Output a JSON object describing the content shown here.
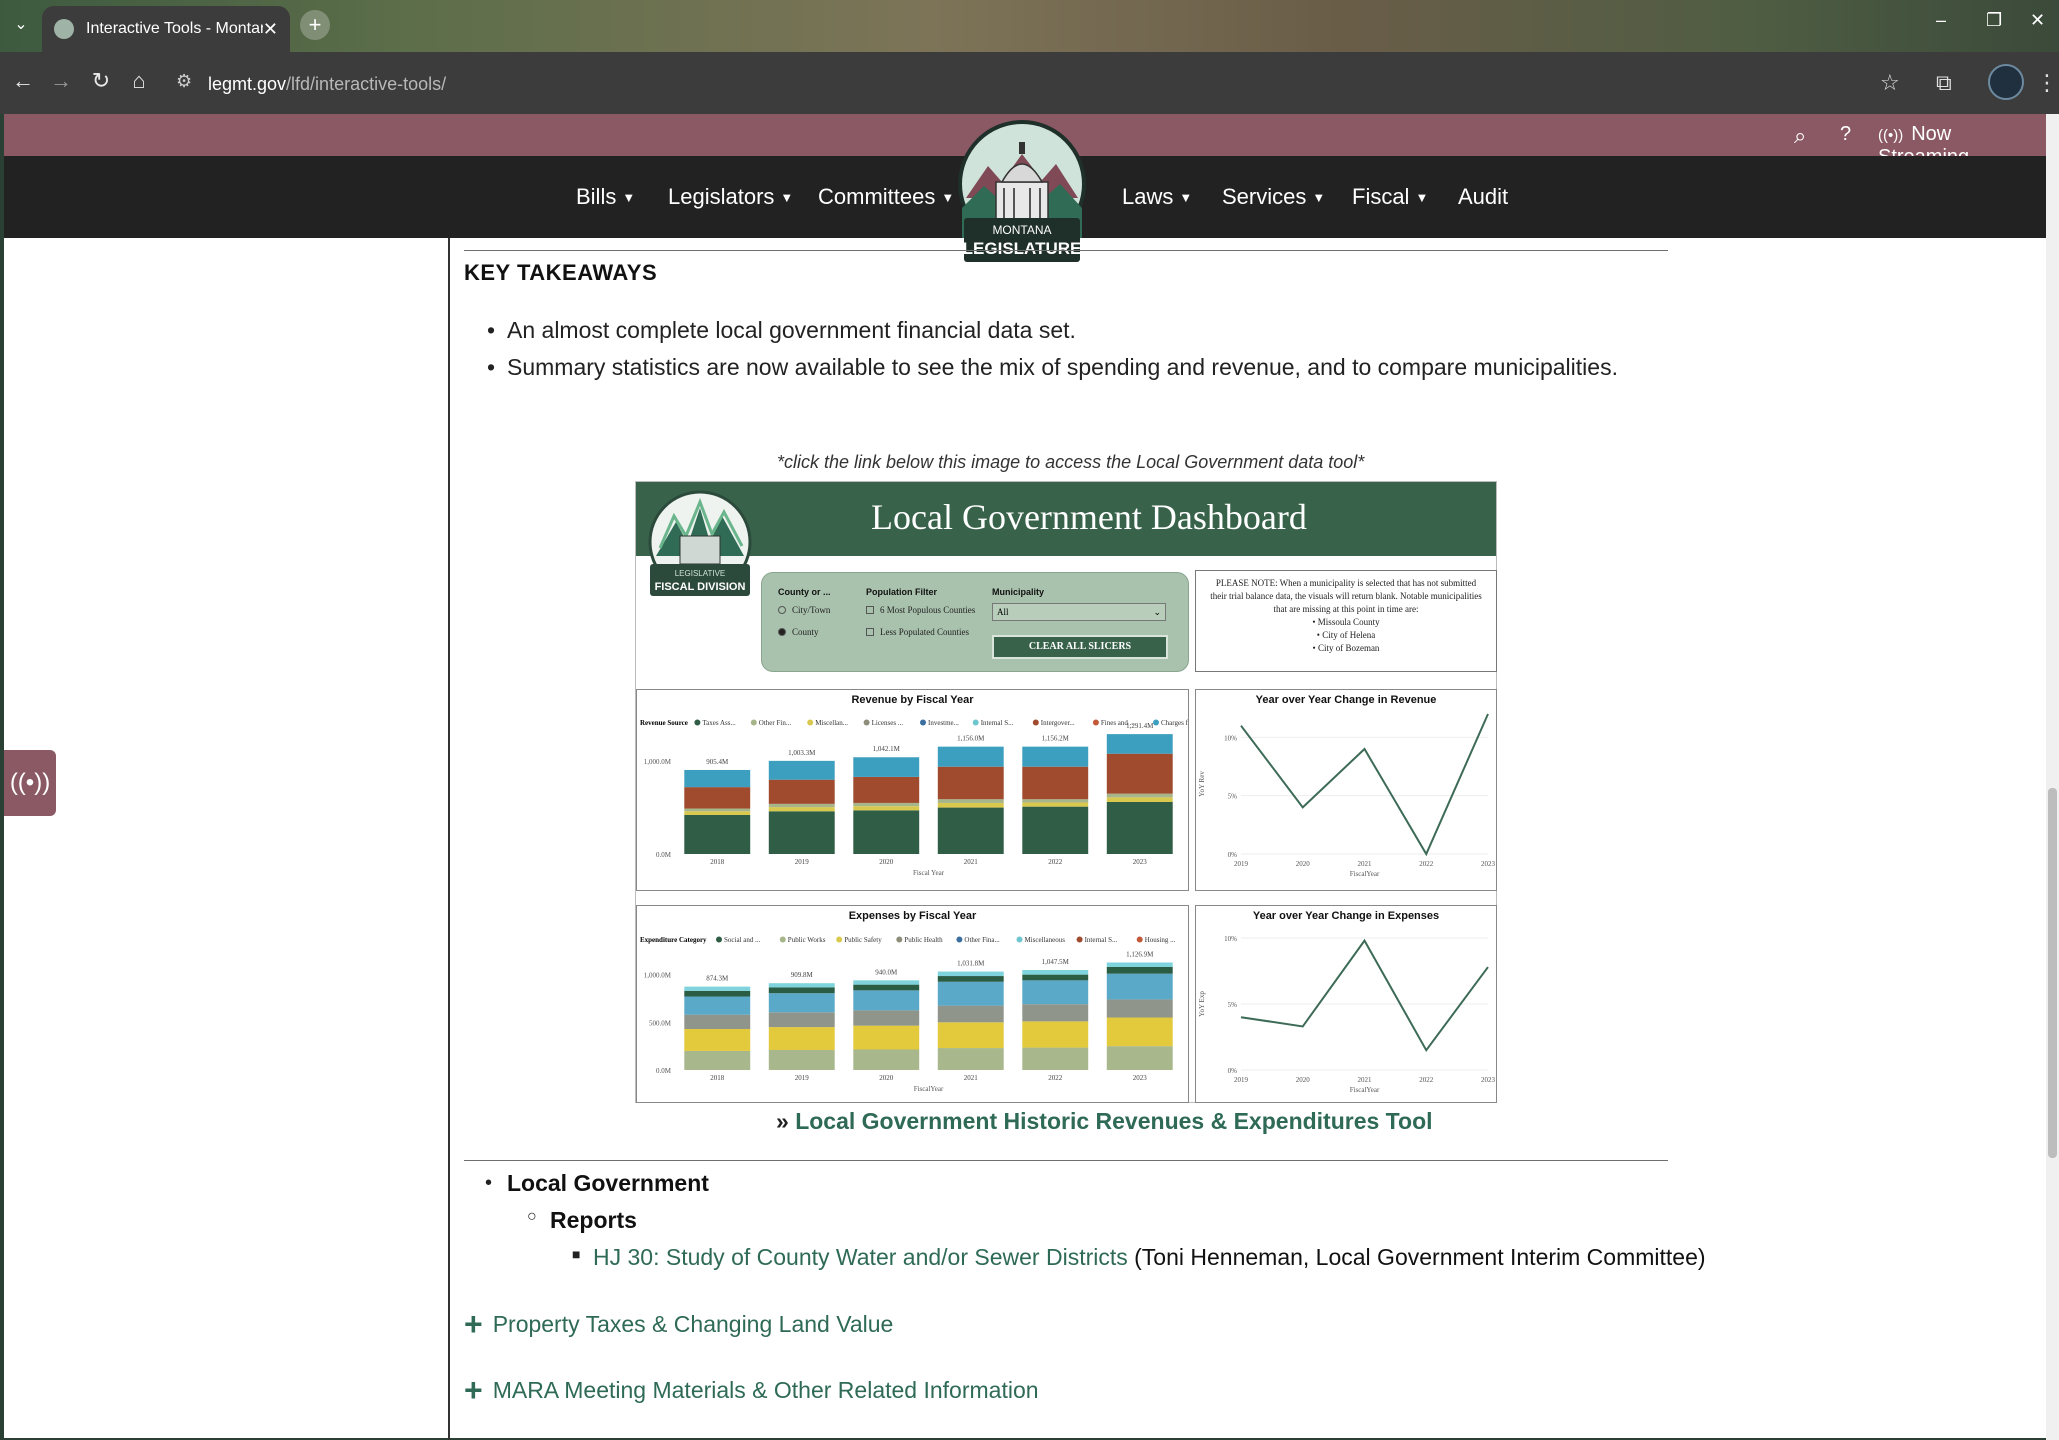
{
  "browser": {
    "tab_title": "Interactive Tools - Montana Leg",
    "tab_close": "✕",
    "new_tab": "+",
    "url_domain": "legmt.gov",
    "url_path": "/lfd/interactive-tools/",
    "window_controls": {
      "minimize": "–",
      "restore": "❐",
      "close": "✕"
    }
  },
  "site": {
    "utility": {
      "search_glyph": "⌕",
      "help": "?",
      "streaming_glyph": "((•))",
      "streaming_label": "Now Streaming"
    },
    "nav_left": [
      {
        "label": "Bills"
      },
      {
        "label": "Legislators"
      },
      {
        "label": "Committees"
      }
    ],
    "nav_right": [
      {
        "label": "Laws"
      },
      {
        "label": "Services"
      },
      {
        "label": "Fiscal"
      },
      {
        "label": "Audit"
      }
    ],
    "logo": {
      "line1": "MONTANA",
      "line2": "LEGISLATURE"
    },
    "side_button_glyph": "((•))"
  },
  "content": {
    "key_takeaways_heading": "KEY TAKEAWAYS",
    "takeaways": [
      "An almost complete local government financial data set.",
      "Summary statistics are now available to see the mix of spending and revenue, and to compare municipalities."
    ],
    "image_caption": "*click the link below this image to access the Local Government data tool*",
    "tool_link_prefix": "»",
    "tool_link": "Local Government Historic Revenues & Expenditures Tool",
    "list": {
      "section": "Local Government",
      "subsection": "Reports",
      "report_link": "HJ 30: Study of County Water and/or Sewer Districts",
      "report_note": " (Toni Henneman, Local Government Interim Committee)"
    },
    "accordions": [
      {
        "label": "Property Taxes & Changing Land Value"
      },
      {
        "label": "MARA Meeting Materials & Other Related Information"
      }
    ]
  },
  "dashboard": {
    "title": "Local Government Dashboard",
    "logo_line1": "LEGISLATIVE",
    "logo_line2": "FISCAL DIVISION",
    "slicers": {
      "county_label": "County or ...",
      "county_options": [
        "City/Town",
        "County"
      ],
      "population_label": "Population Filter",
      "population_options": [
        "6 Most Populous Counties",
        "Less Populated Counties"
      ],
      "municipality_label": "Municipality",
      "municipality_value": "All",
      "clear_label": "CLEAR ALL SLICERS"
    },
    "note_lines": [
      "PLEASE NOTE: When a municipality is selected that has not submitted",
      "their trial balance data, the visuals will return blank. Notable municipalities",
      "that are missing at this point in time are:",
      "• Missoula County",
      "• City of Helena",
      "• City of Bozeman"
    ]
  },
  "chart_data": [
    {
      "type": "bar",
      "title": "Revenue by Fiscal Year",
      "legend_title": "Revenue Source",
      "legend_labels": [
        "Taxes Ass...",
        "Other Fin...",
        "Miscellan...",
        "Licenses ...",
        "Investme...",
        "Internal S...",
        "Intergover...",
        "Fines and ...",
        "Charges f..."
      ],
      "xlabel": "Fiscal Year",
      "categories": [
        "2018",
        "2019",
        "2020",
        "2021",
        "2022",
        "2023"
      ],
      "totals": [
        905.4,
        1003.3,
        1042.1,
        1156.0,
        1156.2,
        1291.4
      ],
      "total_labels": [
        "905.4M",
        "1,003.3M",
        "1,042.1M",
        "1,156.0M",
        "1,156.2M",
        "1,291.4M"
      ],
      "yticks": [
        "0.0M",
        "1,000.0M"
      ],
      "ylim": [
        0,
        1400
      ],
      "series": [
        {
          "color": "#2f5d45",
          "values": [
            420,
            460,
            470,
            500,
            510,
            560
          ]
        },
        {
          "color": "#d9c84e",
          "values": [
            40,
            45,
            45,
            50,
            45,
            50
          ]
        },
        {
          "color": "#a7b58a",
          "values": [
            30,
            35,
            35,
            40,
            35,
            40
          ]
        },
        {
          "color": "#a04a2e",
          "values": [
            230,
            260,
            280,
            350,
            350,
            430
          ]
        },
        {
          "color": "#3d9fbf",
          "values": [
            185,
            203,
            212,
            216,
            216,
            211
          ]
        }
      ]
    },
    {
      "type": "line",
      "title": "Year over Year Change in Revenue",
      "ylabel": "YoY Rev",
      "xlabel": "FiscalYear",
      "x": [
        "2019",
        "2020",
        "2021",
        "2022",
        "2023"
      ],
      "y": [
        11.0,
        4.0,
        9.0,
        0.0,
        12.0
      ],
      "yticks": [
        "0%",
        "5%",
        "10%"
      ],
      "ylim": [
        0,
        12
      ],
      "color": "#3d6b57"
    },
    {
      "type": "bar",
      "title": "Expenses by Fiscal Year",
      "legend_title": "Expenditure Category",
      "legend_labels": [
        "Social and ...",
        "Public Works",
        "Public Safety",
        "Public Health",
        "Other Fina...",
        "Miscellaneous",
        "Internal S...",
        "Housing ..."
      ],
      "xlabel": "FiscalYear",
      "categories": [
        "2018",
        "2019",
        "2020",
        "2021",
        "2022",
        "2023"
      ],
      "totals": [
        874.3,
        909.8,
        940.0,
        1031.8,
        1047.5,
        1126.9
      ],
      "total_labels": [
        "874.3M",
        "909.8M",
        "940.0M",
        "1,031.8M",
        "1,047.5M",
        "1,126.9M"
      ],
      "yticks": [
        "0.0M",
        "500.0M",
        "1,000.0M"
      ],
      "ylim": [
        0,
        1300
      ],
      "series": [
        {
          "color": "#a9b88c",
          "values": [
            200,
            210,
            215,
            230,
            235,
            250
          ]
        },
        {
          "color": "#e3c93c",
          "values": [
            230,
            240,
            250,
            270,
            275,
            300
          ]
        },
        {
          "color": "#8f958a",
          "values": [
            150,
            155,
            160,
            175,
            180,
            190
          ]
        },
        {
          "color": "#5aa9c9",
          "values": [
            190,
            200,
            210,
            250,
            250,
            270
          ]
        },
        {
          "color": "#2b5d45",
          "values": [
            60,
            60,
            60,
            60,
            60,
            70
          ]
        },
        {
          "color": "#7ed3dc",
          "values": [
            44,
            45,
            45,
            47,
            48,
            47
          ]
        }
      ]
    },
    {
      "type": "line",
      "title": "Year over Year Change in Expenses",
      "ylabel": "YoY Exp",
      "xlabel": "FiscalYear",
      "x": [
        "2019",
        "2020",
        "2021",
        "2022",
        "2023"
      ],
      "y": [
        4.0,
        3.3,
        9.8,
        1.5,
        7.8
      ],
      "yticks": [
        "0%",
        "5%",
        "10%"
      ],
      "ylim": [
        0,
        10
      ],
      "color": "#3d6b57"
    }
  ]
}
